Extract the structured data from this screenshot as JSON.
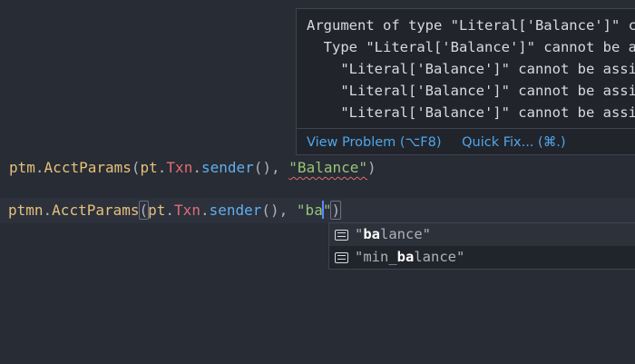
{
  "hover_widget": {
    "lines": [
      "Argument of type \"Literal['Balance']\" cannot be assigned to parameter",
      "  Type \"Literal['Balance']\" cannot be assigned to type",
      "    \"Literal['Balance']\" cannot be assigned to",
      "    \"Literal['Balance']\" cannot be assigned to",
      "    \"Literal['Balance']\" cannot be assigned to"
    ],
    "view_problem": "View Problem (⌥F8)",
    "quick_fix": "Quick Fix... (⌘.)"
  },
  "editor": {
    "line1": {
      "ident": "ptm",
      "dot1": ".",
      "call": "AcctParams",
      "open": "(",
      "module": "pt",
      "dot2": ".",
      "type": "Txn",
      "dot3": ".",
      "method": "sender",
      "args": "(), ",
      "string": "\"Balance\"",
      "close": ")"
    },
    "line2": {
      "ident": "ptmn",
      "dot1": ".",
      "call": "AcctParams",
      "open": "(",
      "module": "pt",
      "dot2": ".",
      "type": "Txn",
      "dot3": ".",
      "method": "sender",
      "args": "(), ",
      "string_start": "\"ba",
      "string_end": "\"",
      "close": ")"
    }
  },
  "suggestions": [
    {
      "pre": "\"",
      "match": "ba",
      "post": "lance\""
    },
    {
      "pre": "\"min_",
      "match": "ba",
      "post": "lance\""
    }
  ],
  "icons": {
    "suggestion": "text-snippet-icon"
  },
  "colors": {
    "background": "#282c34",
    "string": "#98c379",
    "identifier": "#e5c07b",
    "function": "#61afef",
    "type": "#e06c75",
    "link": "#4fa6ed",
    "error_squiggle": "#e06c75"
  }
}
